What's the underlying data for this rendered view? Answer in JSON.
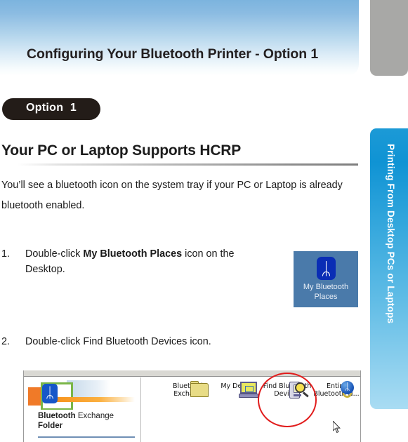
{
  "header": {
    "title": "Configuring Your Bluetooth Printer - Option 1",
    "banner_color": "#7cb4de"
  },
  "side_tabs": {
    "gray_tab_color": "#a8a8a6",
    "active_tab_label": "Printing From Desktop PCs or Laptops",
    "active_tab_color": "#1c9ad6"
  },
  "option_badge": {
    "label": "Option  1",
    "background": "#231c18",
    "text_color": "#ffffff"
  },
  "section": {
    "heading": "Your PC or Laptop Supports HCRP",
    "intro": "You’ll see a bluetooth icon on the system tray if your PC or Laptop is already bluetooth enabled."
  },
  "steps": [
    {
      "number": "1.",
      "text_before": "Double-click ",
      "text_bold": "My Bluetooth Places",
      "text_after": " icon on the Desktop."
    },
    {
      "number": "2.",
      "text_before": "Double-click Find Bluetooth Devices icon.",
      "text_bold": "",
      "text_after": ""
    }
  ],
  "desktop_icon_figure": {
    "bluetooth_glyph": "ᛦ",
    "caption_line1": "My Bluetooth",
    "caption_line2": "Places",
    "background": "#4a7aaa"
  },
  "explorer_screenshot": {
    "left_panel": {
      "title_bold": "Bluetooth",
      "title_rest": " Exchange",
      "title_line2": "Folder",
      "bluetooth_glyph": "ᛦ"
    },
    "icons": [
      {
        "name": "bluetooth-exchange-folder",
        "label_line1": "Bluetooth",
        "label_line2": "Exchan...",
        "glyph": "folder-icon"
      },
      {
        "name": "my-device",
        "label_line1": "My Device",
        "label_line2": "",
        "glyph": "monitor-icon"
      },
      {
        "name": "find-bluetooth-devices",
        "label_line1": "Find Bluetooth",
        "label_line2": "Devices",
        "glyph": "find-device-icon"
      },
      {
        "name": "entire-bluetooth-neighborhood",
        "label_line1": "Entire",
        "label_line2": "Bluetooth N...",
        "glyph": "globe-icon"
      }
    ],
    "annotation": {
      "type": "ellipse",
      "color": "#e11c1c",
      "targets": "find-bluetooth-devices"
    }
  }
}
